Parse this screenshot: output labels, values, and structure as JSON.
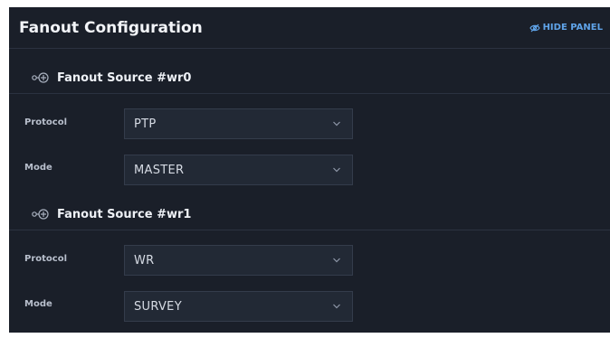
{
  "panel": {
    "title": "Fanout Configuration",
    "hide_label": "HIDE PANEL",
    "hide_icon": "eye-slash-icon"
  },
  "sources": [
    {
      "title": "Fanout Source #wr0",
      "icon": "connector-icon",
      "fields": [
        {
          "label": "Protocol",
          "value": "PTP"
        },
        {
          "label": "Mode",
          "value": "MASTER"
        }
      ]
    },
    {
      "title": "Fanout Source #wr1",
      "icon": "connector-icon",
      "fields": [
        {
          "label": "Protocol",
          "value": "WR"
        },
        {
          "label": "Mode",
          "value": "SURVEY"
        }
      ]
    }
  ],
  "colors": {
    "panel_bg": "#1a1f29",
    "accent": "#5fa3e8",
    "input_bg": "#222935",
    "divider": "#2b3240"
  }
}
